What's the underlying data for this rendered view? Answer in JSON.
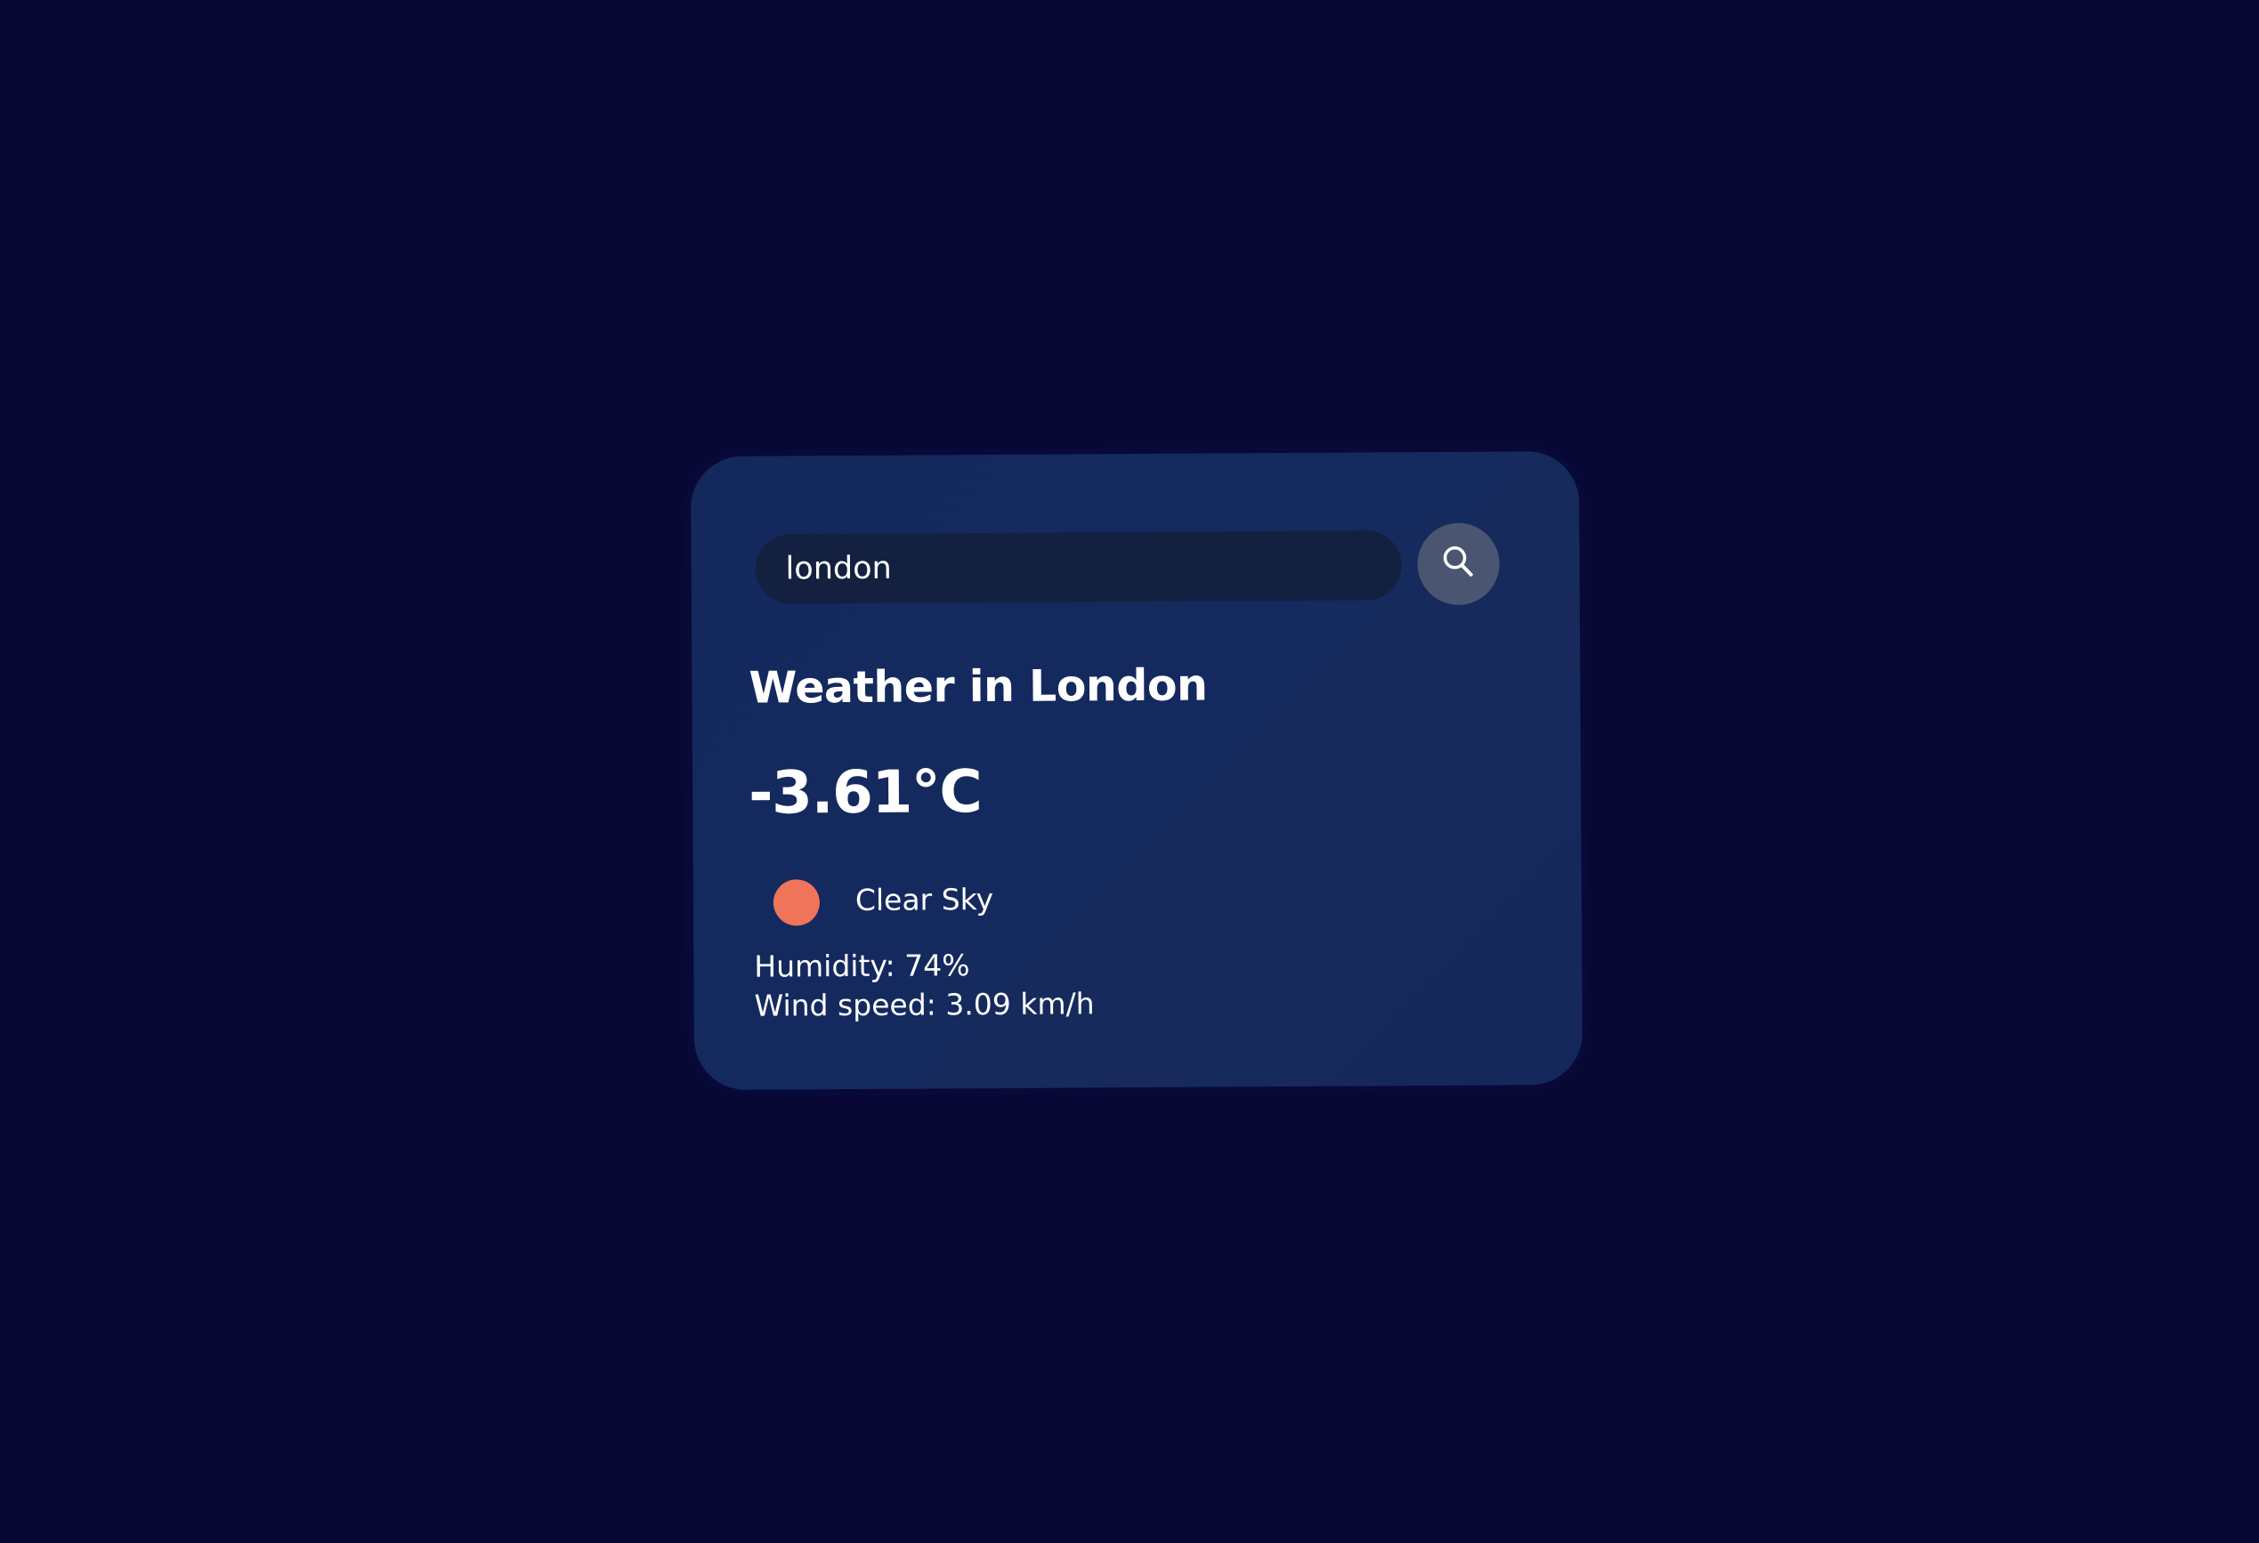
{
  "search": {
    "value": "london",
    "icon": "search-icon"
  },
  "weather": {
    "title": "Weather in London",
    "temperature": "-3.61°C",
    "condition": "Clear Sky",
    "condition_icon": "sun-icon",
    "humidity": "Humidity: 74%",
    "wind": "Wind speed: 3.09 km/h"
  },
  "colors": {
    "background": "#070733",
    "card": "#142a5e",
    "input": "#13203f",
    "button": "#4a5572",
    "sun": "#f07459",
    "text": "#ffffff"
  }
}
